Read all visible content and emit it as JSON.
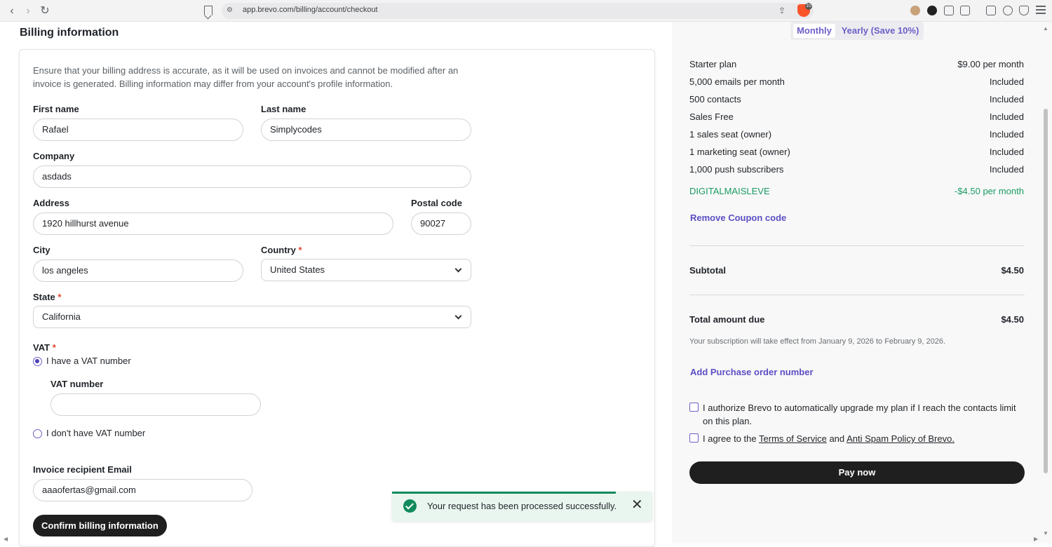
{
  "browser": {
    "url": "app.brevo.com/billing/account/checkout",
    "badge": "10"
  },
  "page": {
    "title": "Billing information",
    "intro": "Ensure that your billing address is accurate, as it will be used on invoices and cannot be modified after an invoice is generated. Billing information may differ from your account's profile information."
  },
  "form": {
    "first_name_label": "First name",
    "first_name_value": "Rafael",
    "last_name_label": "Last name",
    "last_name_value": "Simplycodes",
    "company_label": "Company",
    "company_value": "asdads",
    "address_label": "Address",
    "address_value": "1920 hillhurst avenue",
    "postal_label": "Postal code",
    "postal_value": "90027",
    "city_label": "City",
    "city_value": "los angeles",
    "country_label": "Country",
    "country_value": "United States",
    "state_label": "State",
    "state_value": "California",
    "required_mark": "*",
    "vat_label": "VAT",
    "vat_option_have": "I have a VAT number",
    "vat_number_label": "VAT number",
    "vat_number_value": "",
    "vat_option_none": "I don't have VAT number",
    "email_label": "Invoice recipient Email",
    "email_value": "aaaofertas@gmail.com",
    "confirm_button": "Confirm billing information"
  },
  "toast": {
    "message": "Your request has been processed successfully.",
    "close": "✕"
  },
  "summary": {
    "toggle_monthly": "Monthly",
    "toggle_yearly": "Yearly (Save 10%)",
    "rows": [
      {
        "label": "Starter plan",
        "value": "$9.00 per month"
      },
      {
        "label": "5,000 emails per month",
        "value": "Included"
      },
      {
        "label": "500 contacts",
        "value": "Included"
      },
      {
        "label": "Sales Free",
        "value": "Included"
      },
      {
        "label": "1 sales seat (owner)",
        "value": "Included"
      },
      {
        "label": "1 marketing seat (owner)",
        "value": "Included"
      },
      {
        "label": "1,000 push subscribers",
        "value": "Included"
      }
    ],
    "coupon_code": "DIGITALMAISLEVE",
    "coupon_value": "-$4.50 per month",
    "remove_coupon": "Remove Coupon code",
    "subtotal_label": "Subtotal",
    "subtotal_value": "$4.50",
    "total_label": "Total amount due",
    "total_value": "$4.50",
    "effective_note": "Your subscription will take effect from January 9, 2026 to February 9, 2026.",
    "add_po": "Add Purchase order number",
    "authorize_text": "I authorize Brevo to automatically upgrade my plan if I reach the contacts limit on this plan.",
    "agree_prefix": "I agree to the",
    "terms_link": "Terms of Service",
    "agree_and": "and",
    "antispam_link": "Anti Spam Policy of Brevo.",
    "pay_button": "Pay now"
  },
  "colors": {
    "accent": "#5b4fc4",
    "success": "#118a5c",
    "coupon": "#1a9b65",
    "required": "#e0452f",
    "button": "#1f1f1f"
  }
}
